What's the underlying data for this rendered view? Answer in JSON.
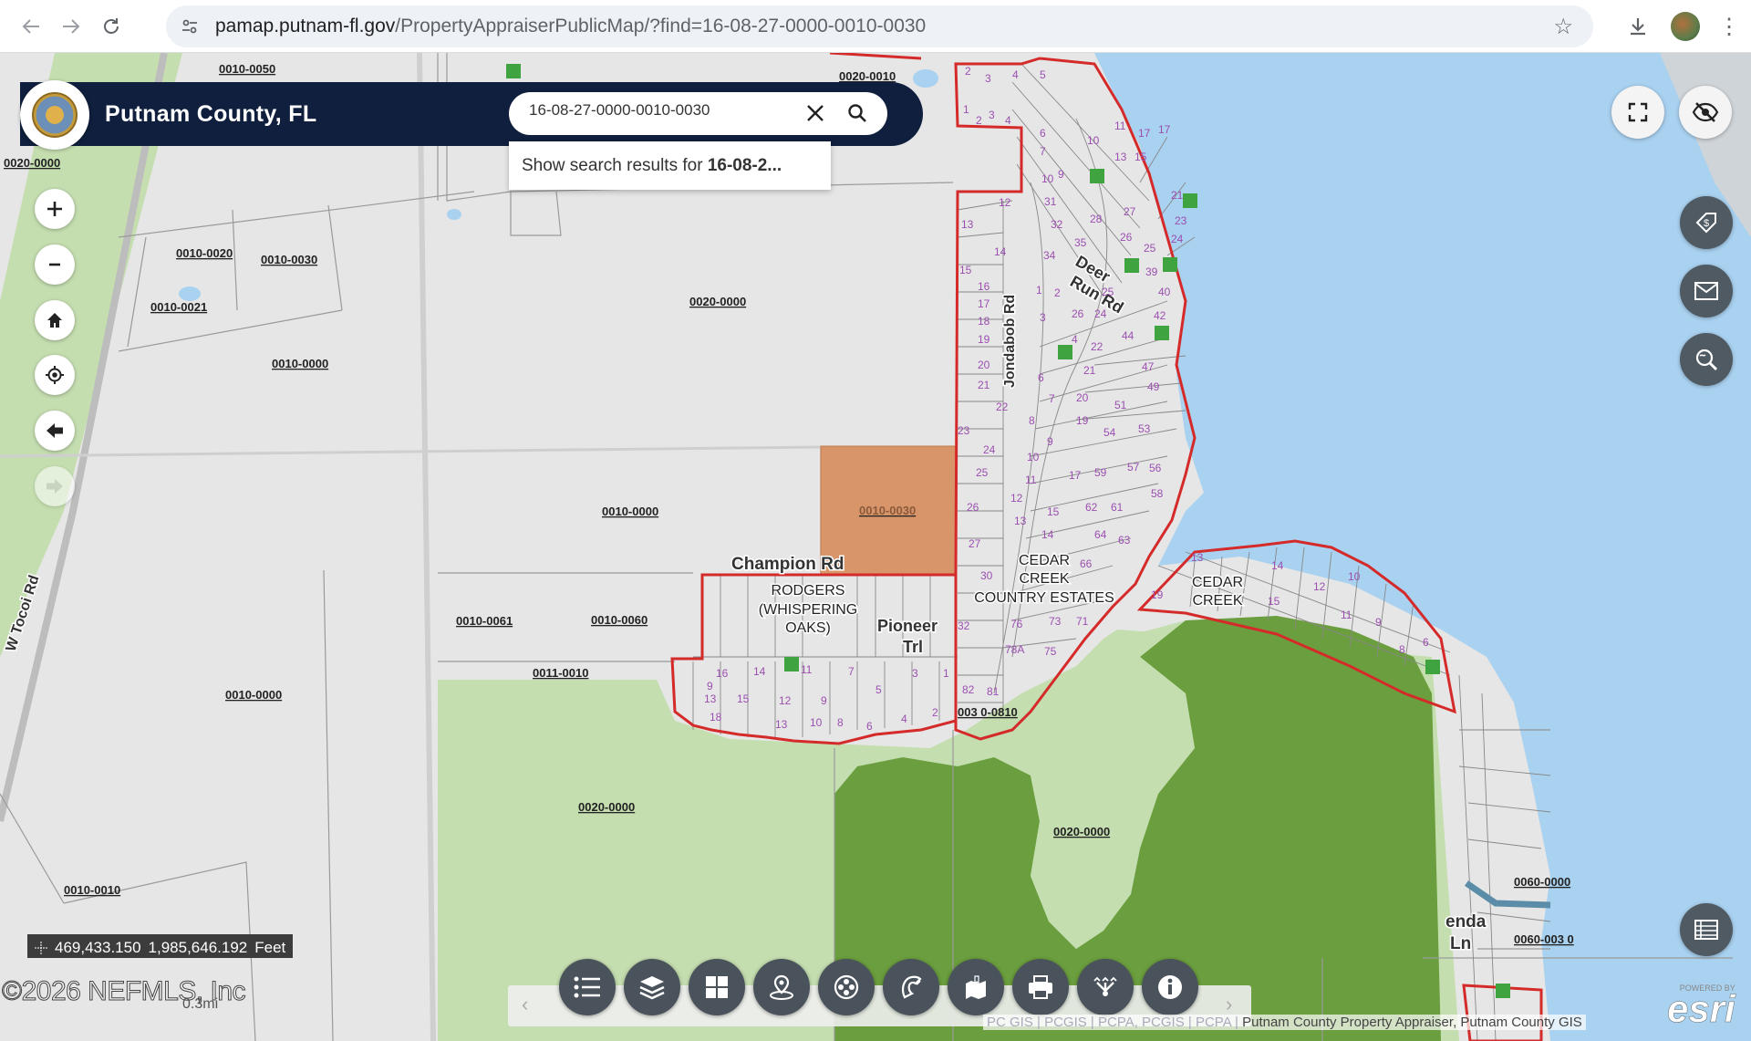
{
  "browser": {
    "url_domain": "pamap.putnam-fl.gov",
    "url_path": "/PropertyAppraiserPublicMap/?find=16-08-27-0000-0010-0030"
  },
  "app": {
    "title": "Putnam County, FL",
    "search_value": "16-08-27-0000-0010-0030",
    "suggestion_prefix": "Show search results for ",
    "suggestion_bold": "16-08-2..."
  },
  "map": {
    "coordinates_x": "469,433.150",
    "coordinates_y": "1,985,646.192",
    "coordinates_unit": "Feet",
    "copyright": "©2026 NEFMLS, Inc",
    "scale_label": "0.3mi",
    "attribution_faint": "PC GIS | PCGIS | PCPA, PCGIS | PCPA | ",
    "attribution": "Putnam County Property Appraiser, Putnam County GIS",
    "esri_powered": "POWERED BY",
    "esri_logo": "esri",
    "parcel_labels": {
      "p1": "0010-0050",
      "p2": "0020-0010",
      "p3": "0020-0000",
      "p4": "0010-0020",
      "p5": "0010-0030",
      "p6": "0010-0021",
      "p7": "0020-0000",
      "p8": "0010-0000",
      "p9": "0010-0000",
      "p10": "0010-0030",
      "p11": "0010-0061",
      "p12": "0010-0060",
      "p13": "0011-0010",
      "p14": "0010-0000",
      "p15": "0020-0000",
      "p16": "0020-0000",
      "p17": "0010-0010",
      "p18": "003 0-0810",
      "p19": "0060-0000",
      "p20": "0060-003 0"
    },
    "road_labels": {
      "r1": "Champion Rd",
      "r2": "Pioneer",
      "r3": "Trl",
      "r4": "Jondabob Rd",
      "r5": "Deer",
      "r6": "Run Rd",
      "r7": "W Tocoi Rd",
      "r8": "enda",
      "r9": "Ln"
    },
    "subdivision_labels": {
      "s1a": "RODGERS",
      "s1b": "(WHISPERING",
      "s1c": "OAKS)",
      "s2a": "CEDAR",
      "s2b": "CREEK",
      "s2c": "COUNTRY ESTATES",
      "s3a": "CEDAR",
      "s3b": "CREEK"
    }
  },
  "icons": {
    "back": "arrow-left-icon",
    "forward": "arrow-right-icon",
    "reload": "reload-icon",
    "star": "star-icon",
    "download": "download-icon"
  },
  "colors": {
    "header_bg": "#0f1f3d",
    "parcel_highlight": "#d9956a",
    "subdivision_border": "#d42a2a",
    "water": "#a9d1f0",
    "forest": "#6b9e3e",
    "light_green": "#c5deb0"
  }
}
